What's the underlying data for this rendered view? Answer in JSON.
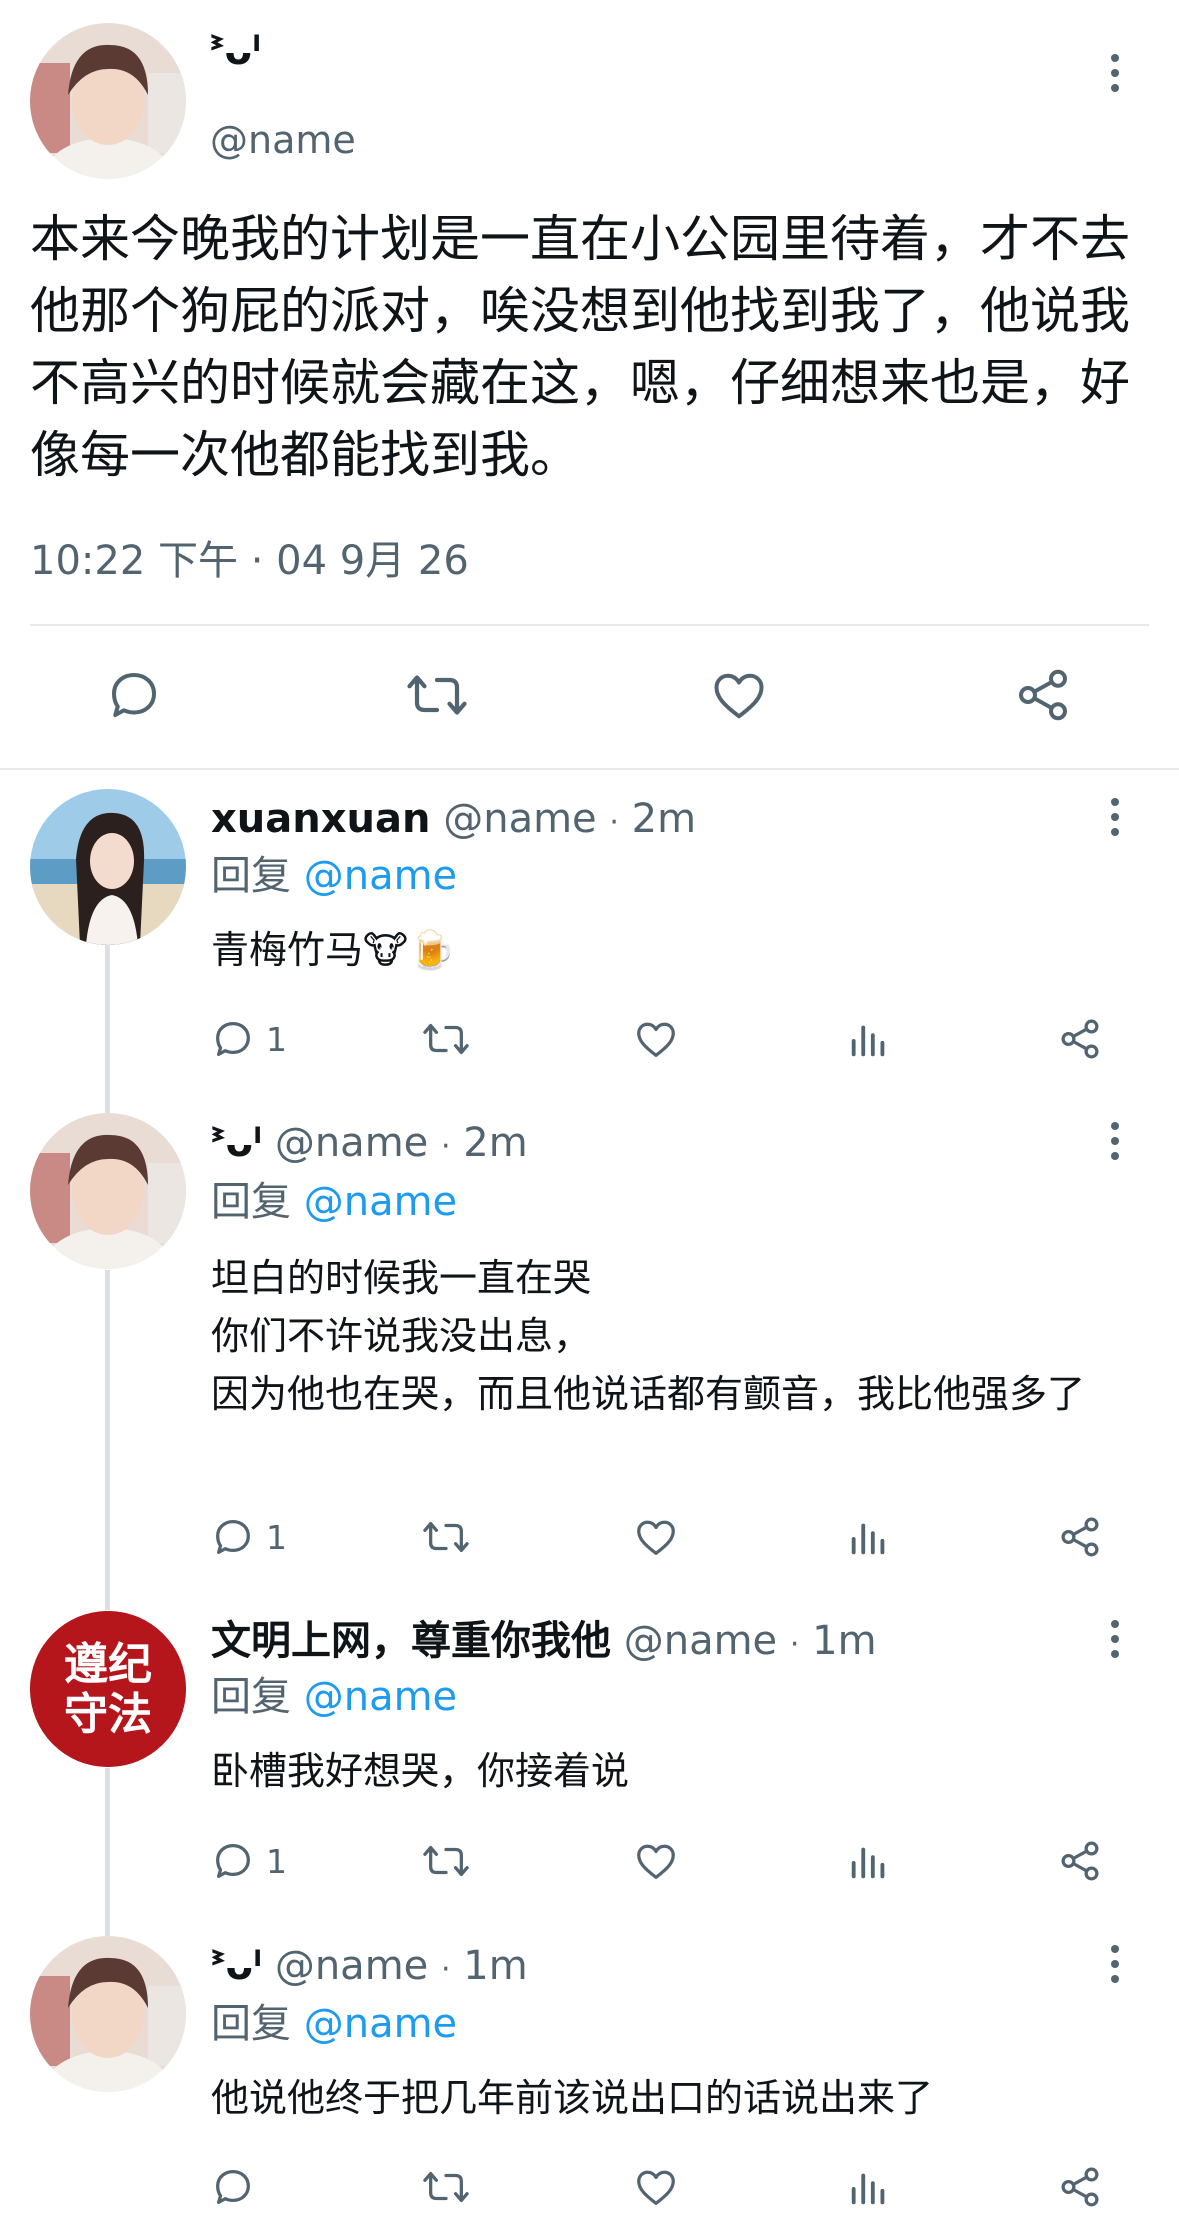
{
  "main_post": {
    "display_name": "ᕑᴗᑊ",
    "handle": "@name",
    "text": "本来今晚我的计划是一直在小公园里待着，才不去他那个狗屁的派对，唉没想到他找到我了，他说我不高兴的时候就会藏在这，嗯，仔细想来也是，好像每一次他都能找到我。",
    "timestamp": "10:22 下午 · 04 9月 26"
  },
  "replies": [
    {
      "name": "xuanxuan",
      "handle": "@name",
      "sep": "·",
      "time": "2m",
      "reply_prefix": "回复",
      "reply_to": "@name",
      "text": "青梅竹马🐮🍺",
      "reply_count": "1"
    },
    {
      "name": "ᕑᴗᑊ",
      "handle": "@name",
      "sep": "·",
      "time": "2m",
      "reply_prefix": "回复",
      "reply_to": "@name",
      "text": "坦白的时候我一直在哭\n你们不许说我没出息，\n因为他也在哭，而且他说话都有颤音，我比他强多了",
      "reply_count": "1"
    },
    {
      "name": "文明上网，尊重你我他",
      "handle": "@name",
      "sep": "·",
      "time": "1m",
      "reply_prefix": "回复",
      "reply_to": "@name",
      "text": "卧槽我好想哭，你接着说",
      "reply_count": "1",
      "avatar_text": [
        "遵纪",
        "守法"
      ]
    },
    {
      "name": "ᕑᴗᑊ",
      "handle": "@name",
      "sep": "·",
      "time": "1m",
      "reply_prefix": "回复",
      "reply_to": "@name",
      "text": "他说他终于把几年前该说出口的话说出来了",
      "reply_count": ""
    }
  ],
  "icons": {
    "reply": "speech-bubble-icon",
    "retweet": "retweet-icon",
    "like": "heart-icon",
    "views": "bar-chart-icon",
    "share": "share-icon",
    "more": "vertical-dots-icon"
  },
  "colors": {
    "text": "#0f1419",
    "muted": "#536471",
    "link": "#1d9bf0",
    "divider": "#e6e8ea",
    "thread_line": "#dcdfe3",
    "badge_red": "#b5161c"
  }
}
